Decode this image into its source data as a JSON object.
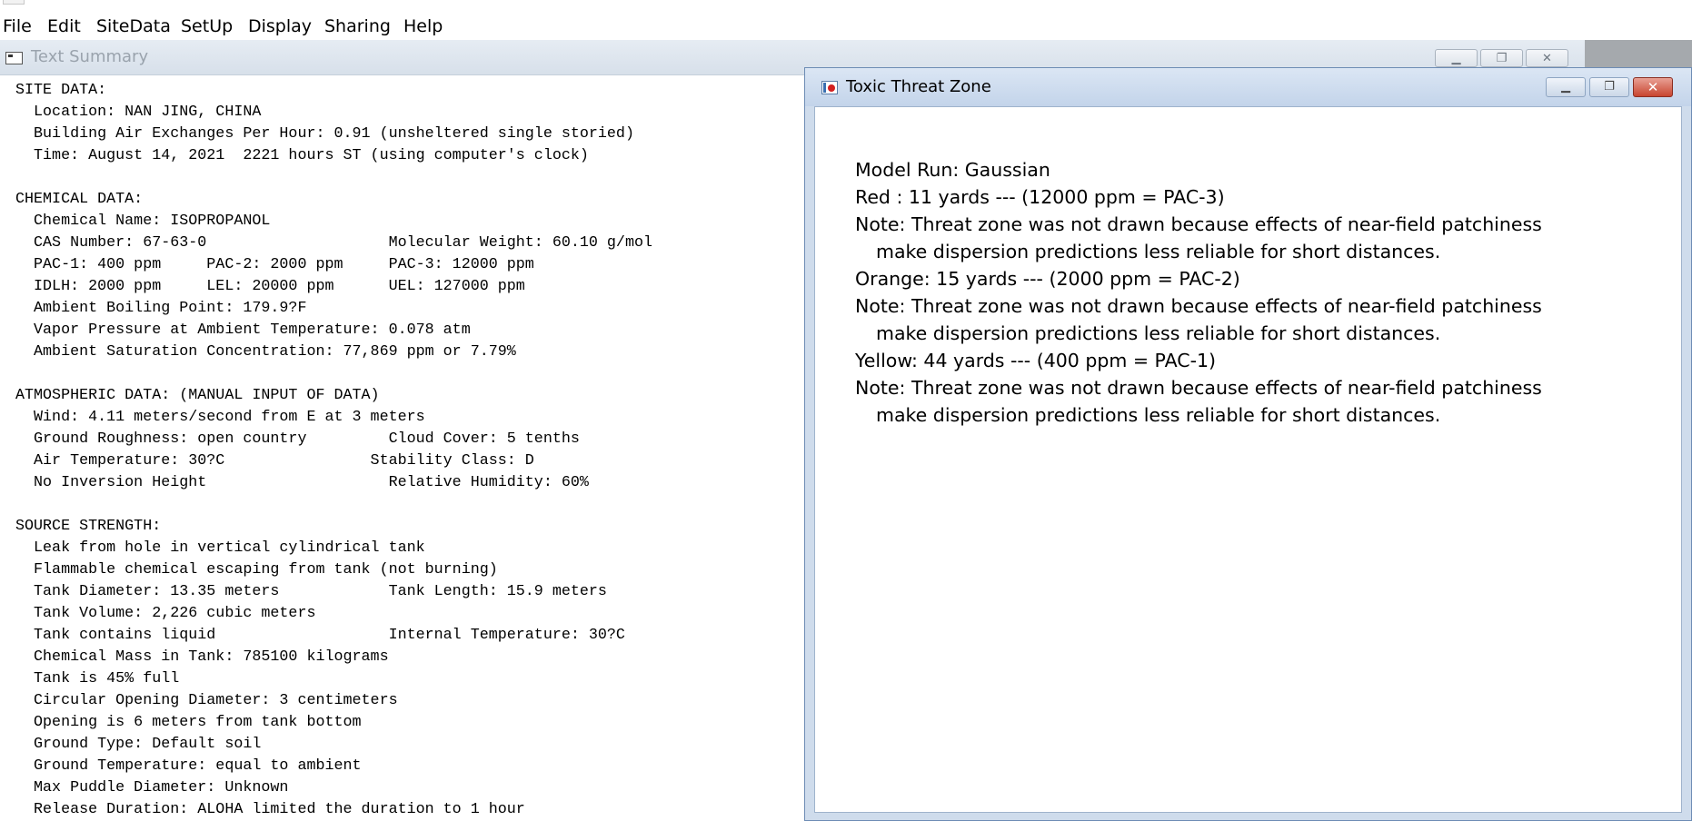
{
  "menubar": {
    "items": [
      "File",
      "Edit",
      "SiteData",
      "SetUp",
      "Display",
      "Sharing",
      "Help"
    ]
  },
  "text_summary": {
    "title": "Text Summary",
    "lines": [
      "SITE DATA:",
      "  Location: NAN JING, CHINA",
      "  Building Air Exchanges Per Hour: 0.91 (unsheltered single storied)",
      "  Time: August 14, 2021  2221 hours ST (using computer's clock)",
      "",
      "CHEMICAL DATA:",
      "  Chemical Name: ISOPROPANOL",
      "  CAS Number: 67-63-0                    Molecular Weight: 60.10 g/mol",
      "  PAC-1: 400 ppm     PAC-2: 2000 ppm     PAC-3: 12000 ppm",
      "  IDLH: 2000 ppm     LEL: 20000 ppm      UEL: 127000 ppm",
      "  Ambient Boiling Point: 179.9?F",
      "  Vapor Pressure at Ambient Temperature: 0.078 atm",
      "  Ambient Saturation Concentration: 77,869 ppm or 7.79%",
      "",
      "ATMOSPHERIC DATA: (MANUAL INPUT OF DATA)",
      "  Wind: 4.11 meters/second from E at 3 meters",
      "  Ground Roughness: open country         Cloud Cover: 5 tenths",
      "  Air Temperature: 30?C                Stability Class: D",
      "  No Inversion Height                    Relative Humidity: 60%",
      "",
      "SOURCE STRENGTH:",
      "  Leak from hole in vertical cylindrical tank",
      "  Flammable chemical escaping from tank (not burning)",
      "  Tank Diameter: 13.35 meters            Tank Length: 15.9 meters",
      "  Tank Volume: 2,226 cubic meters",
      "  Tank contains liquid                   Internal Temperature: 30?C",
      "  Chemical Mass in Tank: 785100 kilograms",
      "  Tank is 45% full",
      "  Circular Opening Diameter: 3 centimeters",
      "  Opening is 6 meters from tank bottom",
      "  Ground Type: Default soil",
      "  Ground Temperature: equal to ambient",
      "  Max Puddle Diameter: Unknown",
      "  Release Duration: ALOHA limited the duration to 1 hour"
    ]
  },
  "threat_zone": {
    "title": "Toxic Threat Zone",
    "lines": [
      {
        "text": "Model Run: Gaussian",
        "indent": false
      },
      {
        "text": "Red   : 11 yards --- (12000 ppm = PAC-3)",
        "indent": false
      },
      {
        "text": "Note: Threat zone was not drawn because effects of near-field patchiness",
        "indent": false
      },
      {
        "text": "make dispersion predictions less reliable for short distances.",
        "indent": true
      },
      {
        "text": "Orange: 15 yards --- (2000 ppm = PAC-2)",
        "indent": false
      },
      {
        "text": "Note: Threat zone was not drawn because effects of near-field patchiness",
        "indent": false
      },
      {
        "text": "make dispersion predictions less reliable for short distances.",
        "indent": true
      },
      {
        "text": "Yellow: 44 yards --- (400 ppm = PAC-1)",
        "indent": false
      },
      {
        "text": "Note: Threat zone was not drawn because effects of near-field patchiness",
        "indent": false
      },
      {
        "text": "make dispersion predictions less reliable for short distances.",
        "indent": true
      }
    ]
  },
  "colors": {
    "titlebar_active": "#c3d4ea",
    "close_button": "#c8452f",
    "mdi_background": "#ababab"
  },
  "icons": {
    "text_summary": "text-window-icon",
    "threat_zone": "threat-zone-icon",
    "minimize": "minimize-icon",
    "maximize": "maximize-icon",
    "close": "close-icon"
  }
}
